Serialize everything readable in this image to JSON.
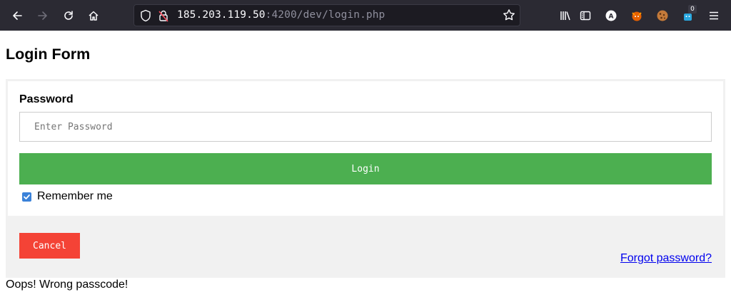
{
  "browser": {
    "url_host": "185.203.119.50",
    "url_rest": ":4200/dev/login.php",
    "extension_badge": "0",
    "toolbar_icons": [
      "back-icon",
      "forward-icon",
      "reload-icon",
      "home-icon",
      "shield-icon",
      "lock-icon",
      "bookmark-star-icon",
      "library-icon",
      "sidebar-icon",
      "account-icon",
      "extension-fox-icon",
      "cookie-icon",
      "extension-badge-icon",
      "menu-icon"
    ]
  },
  "page": {
    "title": "Login Form",
    "password_label": "Password",
    "password_placeholder": "Enter Password",
    "password_value": "",
    "login_label": "Login",
    "remember_label": "Remember me",
    "remember_checked": true,
    "cancel_label": "Cancel",
    "forgot_label": "Forgot password?",
    "error_message": "Oops! Wrong passcode!"
  },
  "colors": {
    "login_button": "#4caf50",
    "cancel_button": "#f44336",
    "footer_background": "#f1f1f1",
    "link": "#0000ee",
    "checkbox": "#3b82d9"
  }
}
